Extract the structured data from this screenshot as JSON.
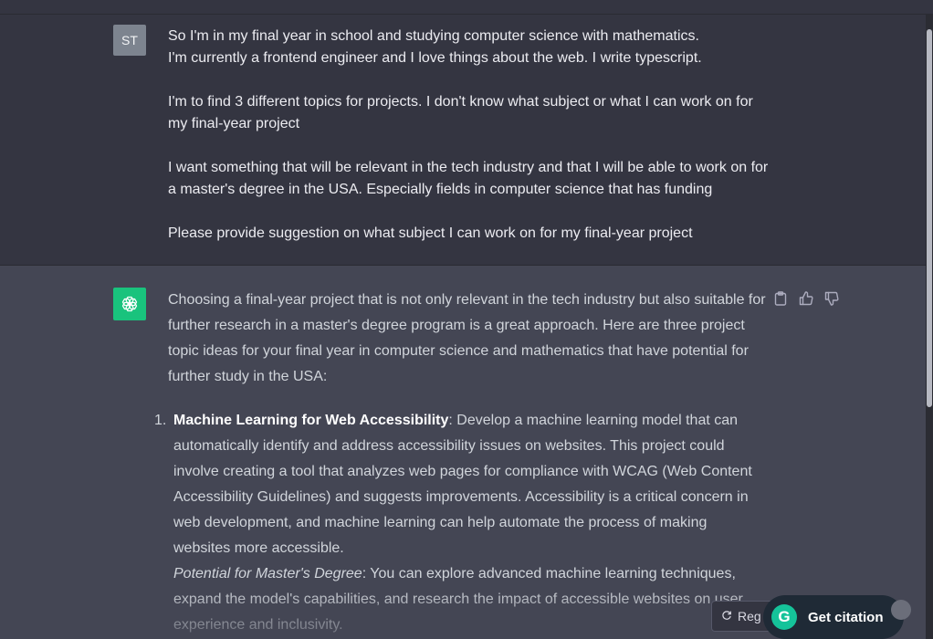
{
  "user_message": {
    "avatar_initials": "ST",
    "paragraphs": [
      "So I'm in my final year in school and studying computer science with mathematics.",
      "I'm currently a frontend engineer and I love things about the web. I write typescript.",
      "I'm to find 3 different topics for projects. I don't know what subject or what I can work on for my final-year project",
      "I want something that will be relevant in the tech industry and that I will be able to work on for a master's degree in the USA. Especially fields in computer science that has funding",
      "Please provide suggestion on what subject I can work on for my final-year project"
    ]
  },
  "assistant_message": {
    "intro": "Choosing a final-year project that is not only relevant in the tech industry but also suitable for further research in a master's degree program is a great approach. Here are three project topic ideas for your final year in computer science and mathematics that have potential for further study in the USA:",
    "items": [
      {
        "number": "1.",
        "title": "Machine Learning for Web Accessibility",
        "description": ": Develop a machine learning model that can automatically identify and address accessibility issues on websites. This project could involve creating a tool that analyzes web pages for compliance with WCAG (Web Content Accessibility Guidelines) and suggests improvements. Accessibility is a critical concern in web development, and machine learning can help automate the process of making websites more accessible.",
        "potential_label": "Potential for Master's Degree",
        "potential_text": ": You can explore advanced machine learning techniques, expand the model's capabilities, and research the impact of accessible websites on user experience and inclusivity."
      }
    ]
  },
  "icons": {
    "assistant_avatar": "openai-logo-icon",
    "copy": "clipboard-icon",
    "thumbs_up": "thumbs-up-icon",
    "thumbs_down": "thumbs-down-icon",
    "regenerate": "refresh-icon",
    "grammarly": "grammarly-logo-icon"
  },
  "regenerate_button": {
    "label": "Reg"
  },
  "citation_button": {
    "logo_letter": "G",
    "label": "Get citation"
  },
  "colors": {
    "background": "#343541",
    "assistant_background": "#444654",
    "assistant_avatar": "#19c37d",
    "user_avatar": "#7d848f",
    "citation_background": "#1f2a36",
    "grammarly_green": "#15c39a"
  }
}
